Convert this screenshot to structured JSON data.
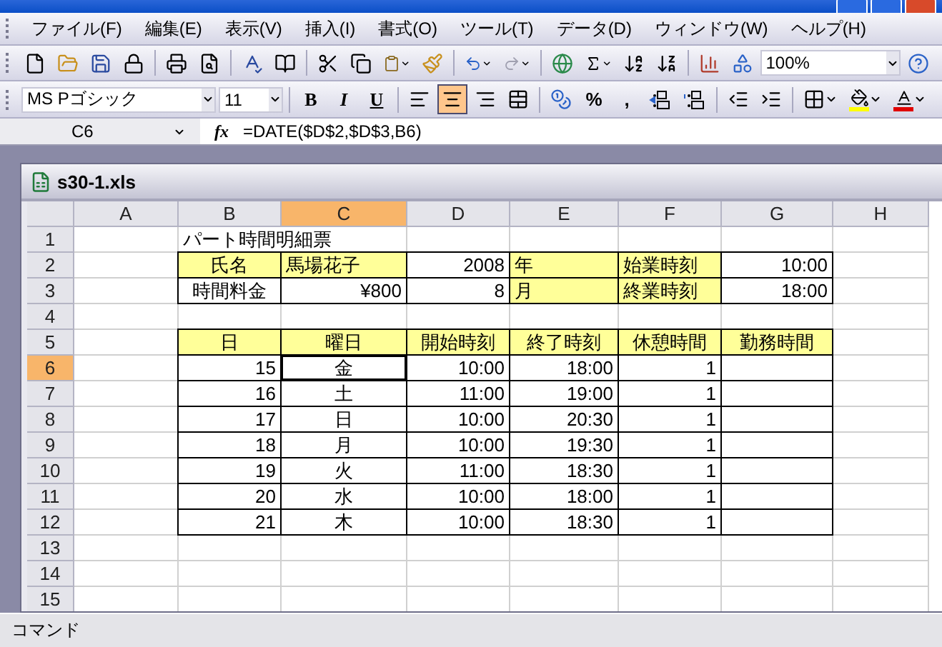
{
  "menu": [
    "ファイル(F)",
    "編集(E)",
    "表示(V)",
    "挿入(I)",
    "書式(O)",
    "ツール(T)",
    "データ(D)",
    "ウィンドウ(W)",
    "ヘルプ(H)"
  ],
  "standard_toolbar": {
    "zoom": "100%"
  },
  "formatting_toolbar": {
    "font": "MS Pゴシック",
    "size": "11",
    "styles": [
      "B",
      "I",
      "U"
    ],
    "alignment": [
      {
        "kind": "left",
        "selected": false
      },
      {
        "kind": "center",
        "selected": true
      },
      {
        "kind": "right",
        "selected": false
      },
      {
        "kind": "merge",
        "selected": false
      }
    ],
    "number_formats": [
      "%",
      ","
    ]
  },
  "formula_bar": {
    "name_box": "C6",
    "fx": "fx",
    "formula": "=DATE($D$2,$D$3,B6)"
  },
  "workbook": {
    "title": "s30-1.xls",
    "columns": [
      {
        "label": "A",
        "selected": false
      },
      {
        "label": "B",
        "selected": false
      },
      {
        "label": "C",
        "selected": true
      },
      {
        "label": "D",
        "selected": false
      },
      {
        "label": "E",
        "selected": false
      },
      {
        "label": "F",
        "selected": false
      },
      {
        "label": "G",
        "selected": false
      },
      {
        "label": "H",
        "selected": false
      }
    ],
    "rows": [
      {
        "label": "1",
        "selected": false,
        "cells": [
          null,
          {
            "text": "パート時間明細票",
            "kind": "text"
          },
          null,
          null,
          null,
          null,
          null,
          null
        ]
      },
      {
        "label": "2",
        "selected": false,
        "cells": [
          null,
          {
            "text": "氏名",
            "kind": "heading",
            "highlighted": true,
            "boxed": true
          },
          {
            "text": "馬場花子",
            "kind": "text",
            "highlighted": true,
            "boxed": true
          },
          {
            "text": "2008",
            "kind": "number",
            "boxed": true
          },
          {
            "text": "年",
            "kind": "text",
            "highlighted": true,
            "boxed": true
          },
          {
            "text": "始業時刻",
            "kind": "text",
            "highlighted": true,
            "boxed": true
          },
          {
            "text": "10:00",
            "kind": "number",
            "boxed": true
          },
          null
        ]
      },
      {
        "label": "3",
        "selected": false,
        "cells": [
          null,
          {
            "text": "時間料金",
            "kind": "heading",
            "boxed": true
          },
          {
            "text": "¥800",
            "kind": "number",
            "boxed": true
          },
          {
            "text": "8",
            "kind": "number",
            "boxed": true
          },
          {
            "text": "月",
            "kind": "text",
            "highlighted": true,
            "boxed": true
          },
          {
            "text": "終業時刻",
            "kind": "text",
            "highlighted": true,
            "boxed": true
          },
          {
            "text": "18:00",
            "kind": "number",
            "boxed": true
          },
          null
        ]
      },
      {
        "label": "4",
        "selected": false,
        "cells": [
          null,
          null,
          null,
          null,
          null,
          null,
          null,
          null
        ]
      },
      {
        "label": "5",
        "selected": false,
        "cells": [
          null,
          {
            "text": "日",
            "kind": "heading",
            "highlighted": true,
            "boxed": true
          },
          {
            "text": "曜日",
            "kind": "heading",
            "highlighted": true,
            "boxed": true
          },
          {
            "text": "開始時刻",
            "kind": "heading",
            "highlighted": true,
            "boxed": true
          },
          {
            "text": "終了時刻",
            "kind": "heading",
            "highlighted": true,
            "boxed": true
          },
          {
            "text": "休憩時間",
            "kind": "heading",
            "highlighted": true,
            "boxed": true
          },
          {
            "text": "勤務時間",
            "kind": "heading",
            "highlighted": true,
            "boxed": true
          },
          null
        ]
      },
      {
        "label": "6",
        "selected": true,
        "cells": [
          null,
          {
            "text": "15",
            "kind": "number",
            "boxed": true
          },
          {
            "text": "金",
            "kind": "heading",
            "boxed": true,
            "selected": true
          },
          {
            "text": "10:00",
            "kind": "number",
            "boxed": true
          },
          {
            "text": "18:00",
            "kind": "number",
            "boxed": true
          },
          {
            "text": "1",
            "kind": "number",
            "boxed": true
          },
          {
            "boxed": true
          },
          null
        ]
      },
      {
        "label": "7",
        "selected": false,
        "cells": [
          null,
          {
            "text": "16",
            "kind": "number",
            "boxed": true
          },
          {
            "text": "土",
            "kind": "heading",
            "boxed": true
          },
          {
            "text": "11:00",
            "kind": "number",
            "boxed": true
          },
          {
            "text": "19:00",
            "kind": "number",
            "boxed": true
          },
          {
            "text": "1",
            "kind": "number",
            "boxed": true
          },
          {
            "boxed": true
          },
          null
        ]
      },
      {
        "label": "8",
        "selected": false,
        "cells": [
          null,
          {
            "text": "17",
            "kind": "number",
            "boxed": true
          },
          {
            "text": "日",
            "kind": "heading",
            "boxed": true
          },
          {
            "text": "10:00",
            "kind": "number",
            "boxed": true
          },
          {
            "text": "20:30",
            "kind": "number",
            "boxed": true
          },
          {
            "text": "1",
            "kind": "number",
            "boxed": true
          },
          {
            "boxed": true
          },
          null
        ]
      },
      {
        "label": "9",
        "selected": false,
        "cells": [
          null,
          {
            "text": "18",
            "kind": "number",
            "boxed": true
          },
          {
            "text": "月",
            "kind": "heading",
            "boxed": true
          },
          {
            "text": "10:00",
            "kind": "number",
            "boxed": true
          },
          {
            "text": "19:30",
            "kind": "number",
            "boxed": true
          },
          {
            "text": "1",
            "kind": "number",
            "boxed": true
          },
          {
            "boxed": true
          },
          null
        ]
      },
      {
        "label": "10",
        "selected": false,
        "cells": [
          null,
          {
            "text": "19",
            "kind": "number",
            "boxed": true
          },
          {
            "text": "火",
            "kind": "heading",
            "boxed": true
          },
          {
            "text": "11:00",
            "kind": "number",
            "boxed": true
          },
          {
            "text": "18:30",
            "kind": "number",
            "boxed": true
          },
          {
            "text": "1",
            "kind": "number",
            "boxed": true
          },
          {
            "boxed": true
          },
          null
        ]
      },
      {
        "label": "11",
        "selected": false,
        "cells": [
          null,
          {
            "text": "20",
            "kind": "number",
            "boxed": true
          },
          {
            "text": "水",
            "kind": "heading",
            "boxed": true
          },
          {
            "text": "10:00",
            "kind": "number",
            "boxed": true
          },
          {
            "text": "18:00",
            "kind": "number",
            "boxed": true
          },
          {
            "text": "1",
            "kind": "number",
            "boxed": true
          },
          {
            "boxed": true
          },
          null
        ]
      },
      {
        "label": "12",
        "selected": false,
        "cells": [
          null,
          {
            "text": "21",
            "kind": "number",
            "boxed": true
          },
          {
            "text": "木",
            "kind": "heading",
            "boxed": true
          },
          {
            "text": "10:00",
            "kind": "number",
            "boxed": true
          },
          {
            "text": "18:30",
            "kind": "number",
            "boxed": true
          },
          {
            "text": "1",
            "kind": "number",
            "boxed": true
          },
          {
            "boxed": true
          },
          null
        ]
      },
      {
        "label": "13",
        "selected": false,
        "cells": [
          null,
          null,
          null,
          null,
          null,
          null,
          null,
          null
        ]
      },
      {
        "label": "14",
        "selected": false,
        "cells": [
          null,
          null,
          null,
          null,
          null,
          null,
          null,
          null
        ]
      },
      {
        "label": "15",
        "selected": false,
        "cells": [
          null,
          null,
          null,
          null,
          null,
          null,
          null,
          null
        ]
      }
    ]
  },
  "status_bar": "コマンド"
}
